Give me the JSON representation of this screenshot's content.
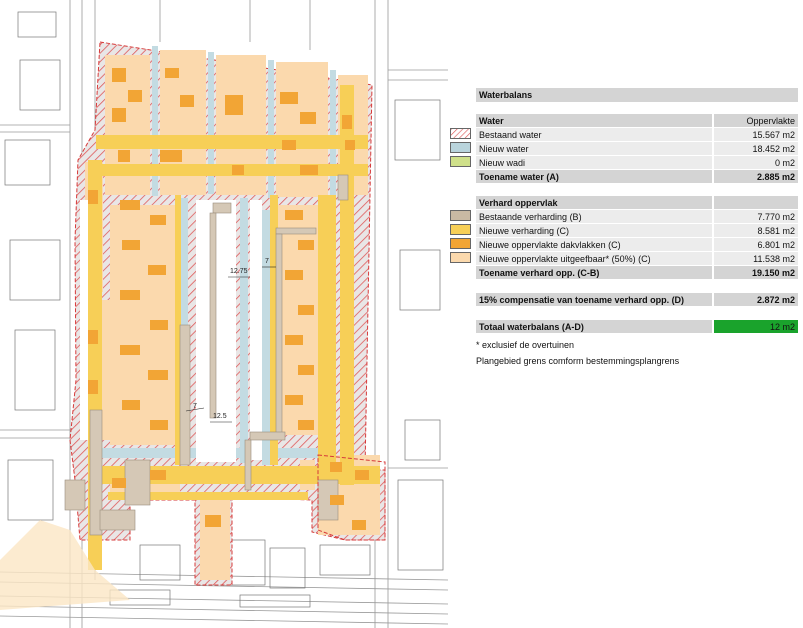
{
  "legend": {
    "title": "Waterbalans",
    "water": {
      "header": "Water",
      "col_header": "Oppervlakte",
      "rows": [
        {
          "label": "Bestaand water",
          "value": "15.567 m2",
          "swatch": "hatch-red"
        },
        {
          "label": "Nieuw water",
          "value": "18.452 m2",
          "swatch": "#b9d4dc"
        },
        {
          "label": "Nieuw wadi",
          "value": "0 m2",
          "swatch": "#cfe08a"
        }
      ],
      "total_label": "Toename water (A)",
      "total_value": "2.885 m2"
    },
    "verhard": {
      "header": "Verhard oppervlak",
      "rows": [
        {
          "label": "Bestaande verharding (B)",
          "value": "7.770 m2",
          "swatch": "#c9b9a3"
        },
        {
          "label": "Nieuwe verharding (C)",
          "value": "8.581 m2",
          "swatch": "#f7cf57"
        },
        {
          "label": "Nieuwe oppervlakte dakvlakken (C)",
          "value": "6.801 m2",
          "swatch": "#f2a535"
        },
        {
          "label": "Nieuwe oppervlakte uitgeefbaar* (50%) (C)",
          "value": "11.538 m2",
          "swatch": "#fbd9ad"
        }
      ],
      "total_label": "Toename verhard opp. (C-B)",
      "total_value": "19.150 m2"
    },
    "compensatie": {
      "label": "15% compensatie van toename verhard opp. (D)",
      "value": "2.872 m2"
    },
    "totaal": {
      "label": "Totaal waterbalans (A-D)",
      "value": "12 m2",
      "color": "#1aa32c"
    },
    "notes": [
      "* exclusief de overtuinen",
      "Plangebied grens comform bestemmingsplangrens"
    ]
  },
  "map": {
    "dimensions": [
      "12.75",
      "7",
      "7",
      "12.5"
    ]
  }
}
